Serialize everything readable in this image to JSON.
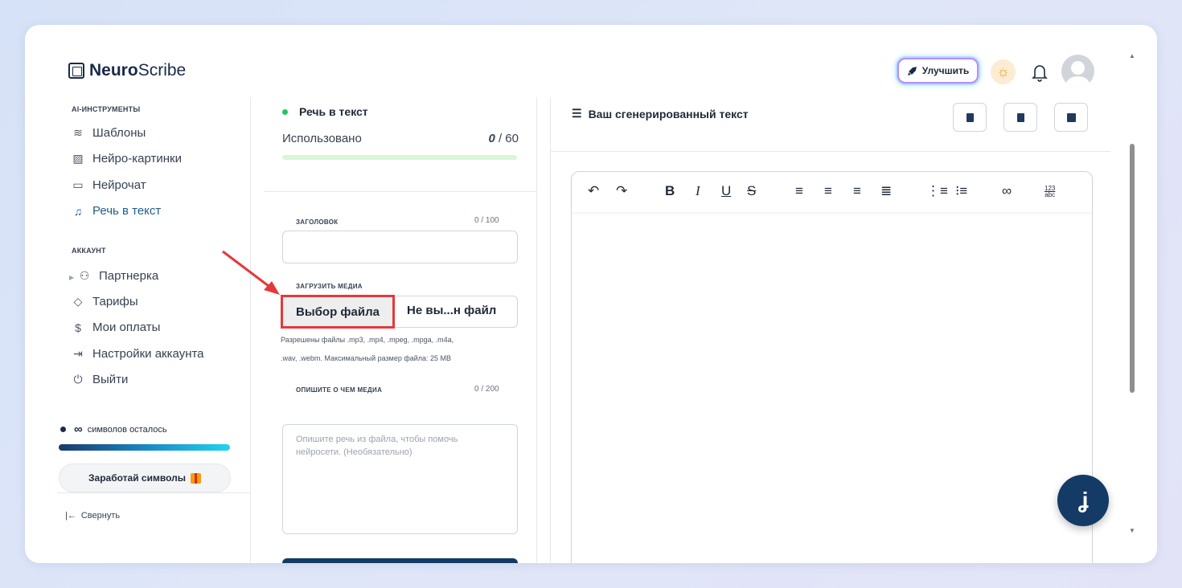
{
  "app": {
    "brand_bold": "Neuro",
    "brand_rest": "Scribe"
  },
  "header": {
    "upgrade_label": "Улучшить"
  },
  "sidebar": {
    "section_tools": "AI-ИНСТРУМЕНТЫ",
    "tools": [
      {
        "label": "Шаблоны",
        "icon": "layers-icon"
      },
      {
        "label": "Нейро-картинки",
        "icon": "image-icon"
      },
      {
        "label": "Нейрочат",
        "icon": "chat-icon"
      },
      {
        "label": "Речь в текст",
        "icon": "headphones-icon",
        "active": true
      }
    ],
    "section_account": "АККАУНТ",
    "account": [
      {
        "label": "Партнерка",
        "icon": "users-icon"
      },
      {
        "label": "Тарифы",
        "icon": "tag-icon"
      },
      {
        "label": "Мои оплаты",
        "icon": "dollar-icon"
      },
      {
        "label": "Настройки аккаунта",
        "icon": "login-icon"
      },
      {
        "label": "Выйти",
        "icon": "power-icon"
      }
    ],
    "credits_symbol": "∞",
    "credits_text": "символов осталось",
    "earn_label": "Заработай символы",
    "collapse_label": "Свернуть"
  },
  "form": {
    "tool_name": "Речь в текст",
    "used_label": "Использовано",
    "used_current": "0",
    "used_total": "/ 60",
    "title_label": "ЗАГОЛОВОК",
    "title_count": "0 / 100",
    "title_value": "",
    "upload_label": "ЗАГРУЗИТЬ МЕДИА",
    "choose_file": "Выбор файла",
    "file_status": "Не вы...н файл",
    "allowed_line1": "Разрешены файлы .mp3, .mp4, .mpeg, .mpga, .m4a,",
    "allowed_line2": ".wav, .webm.  Максимальный размер файла: 25 MB",
    "describe_label": "ОПИШИТЕ О ЧЕМ МЕДИА",
    "describe_count": "0 / 200",
    "describe_placeholder": "Опишите речь из файла, чтобы помочь нейросети. (Необязательно)"
  },
  "output": {
    "title": "Ваш сгенерированный текст",
    "toolbar_numbers_top": "123",
    "toolbar_numbers_bottom": "abc"
  },
  "colors": {
    "accent": "#143a66",
    "highlight": "#e4393c",
    "active_nav": "#1f5f8b",
    "status_green": "#22c55e"
  }
}
